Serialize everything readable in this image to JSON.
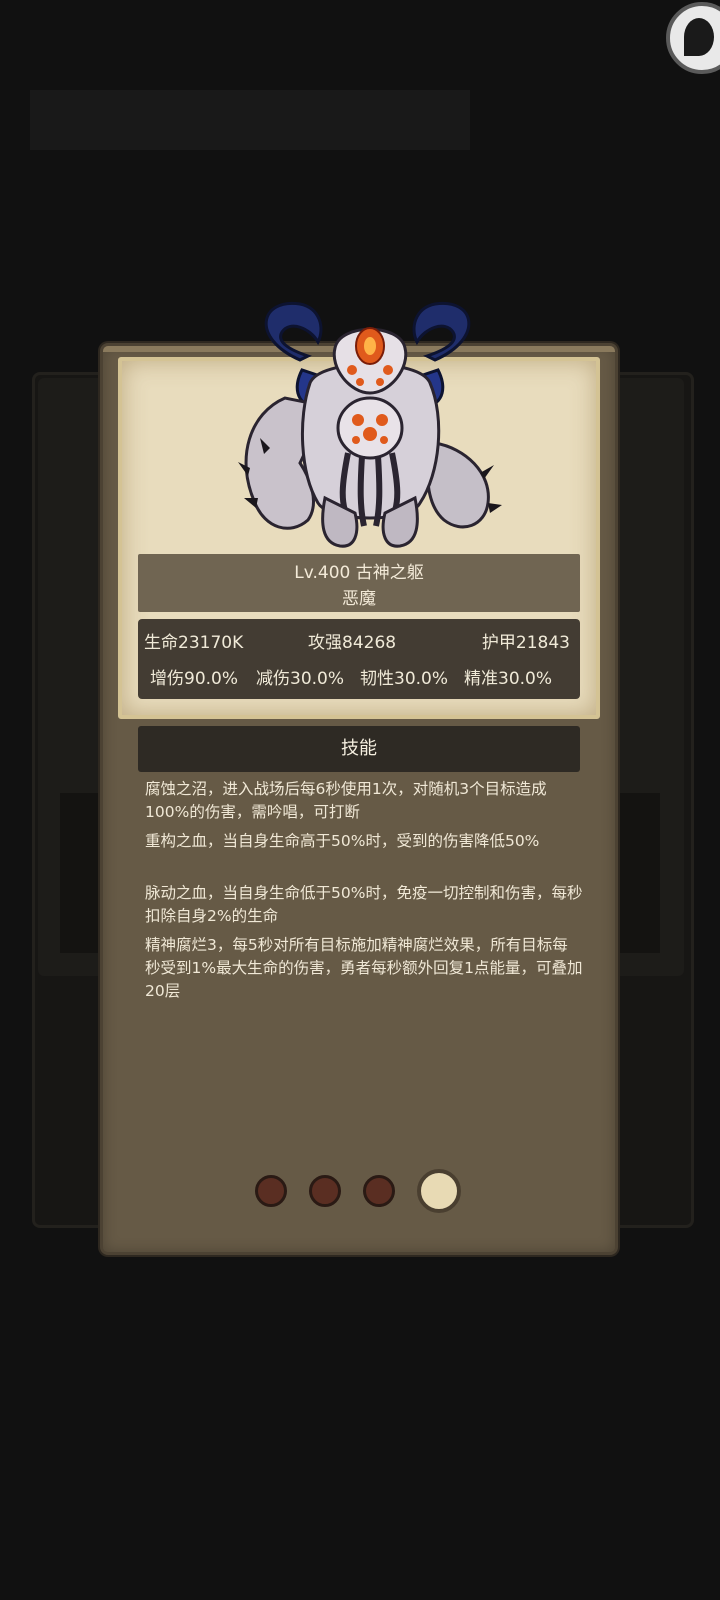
{
  "monster": {
    "name_line": "Lv.400 古神之躯",
    "type": "恶魔"
  },
  "stats": {
    "hp": "生命23170K",
    "attack": "攻强84268",
    "armor": "护甲21843",
    "dmg_up": "增伤90.0%",
    "dmg_reduce": "减伤30.0%",
    "toughness": "韧性30.0%",
    "accuracy": "精准30.0%"
  },
  "skills": {
    "header": "技能",
    "items": [
      "腐蚀之沼，进入战场后每6秒使用1次，对随机3个目标造成100%的伤害，需吟唱，可打断",
      "重构之血，当自身生命高于50%时，受到的伤害降低50%",
      "脉动之血，当自身生命低于50%时，免疫一切控制和伤害，每秒扣除自身2%的生命",
      "精神腐烂3，每5秒对所有目标施加精神腐烂效果，所有目标每秒受到1%最大生命的伤害，勇者每秒额外回复1点能量，可叠加20层"
    ]
  },
  "pagination": {
    "total": 4,
    "active_index": 3
  },
  "colors": {
    "card": "#665a46",
    "parchment": "#e8dcbd",
    "dot_inactive": "#5a2e22",
    "dot_active": "#e8dab4"
  }
}
